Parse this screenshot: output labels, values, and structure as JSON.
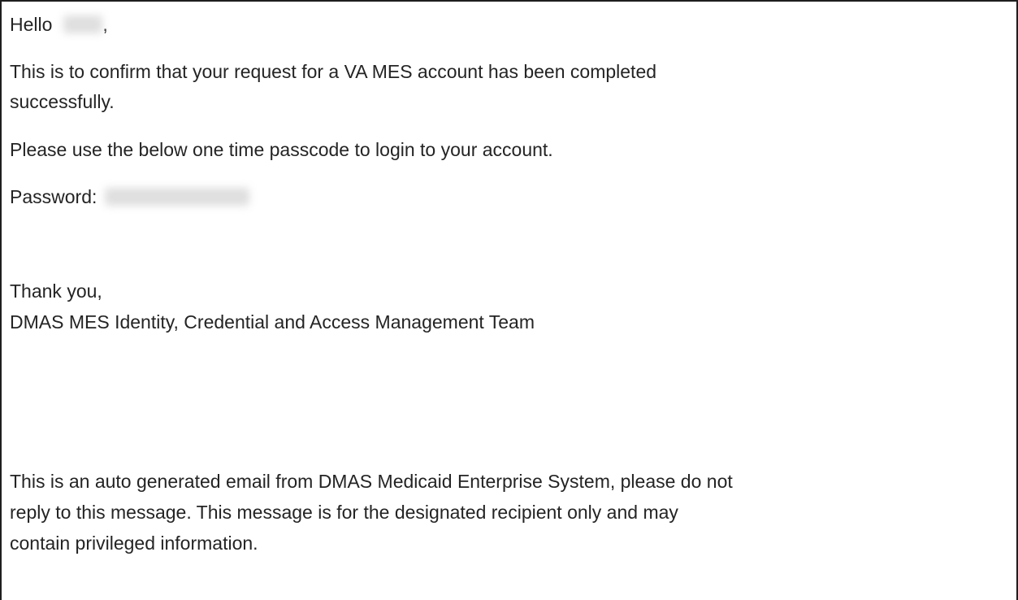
{
  "email": {
    "greeting_word": "Hello",
    "greeting_comma": ",",
    "confirm_line_1": "This is to confirm that your request for a VA MES account has been completed",
    "confirm_line_2": "successfully.",
    "instruction": "Please use the below one time passcode to login to your account.",
    "password_label": "Password:",
    "signoff": "Thank you,",
    "team": "DMAS MES Identity, Credential and Access Management Team",
    "disclaimer_line_1": "This is an auto generated email from DMAS Medicaid Enterprise System, please do not",
    "disclaimer_line_2": "reply to this message. This message is for the designated recipient only and may",
    "disclaimer_line_3": "contain privileged information."
  }
}
